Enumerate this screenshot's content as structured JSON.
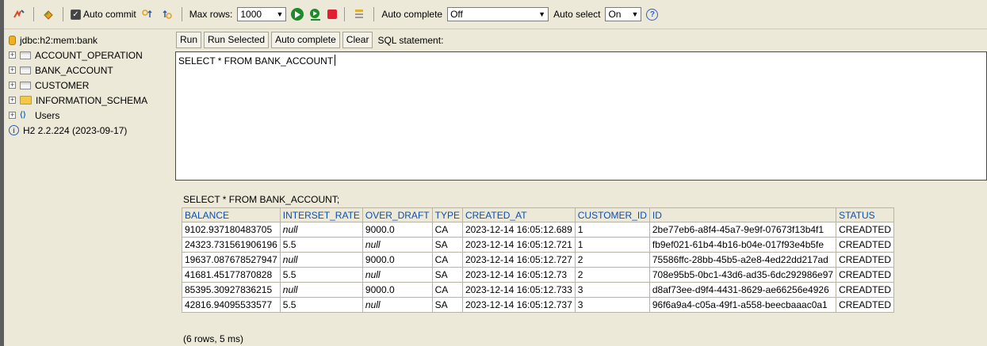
{
  "toolbar": {
    "auto_commit_label": "Auto commit",
    "max_rows_label": "Max rows:",
    "max_rows_value": "1000",
    "auto_complete_label": "Auto complete",
    "auto_complete_value": "Off",
    "auto_select_label": "Auto select",
    "auto_select_value": "On",
    "help_glyph": "?"
  },
  "tree": {
    "connection": "jdbc:h2:mem:bank",
    "items": [
      {
        "label": "ACCOUNT_OPERATION",
        "icon": "table-icon"
      },
      {
        "label": "BANK_ACCOUNT",
        "icon": "table-icon"
      },
      {
        "label": "CUSTOMER",
        "icon": "table-icon"
      },
      {
        "label": "INFORMATION_SCHEMA",
        "icon": "folder-icon"
      },
      {
        "label": "Users",
        "icon": "users-icon"
      }
    ],
    "version": "H2 2.2.224 (2023-09-17)"
  },
  "editor": {
    "buttons": [
      "Run",
      "Run Selected",
      "Auto complete",
      "Clear"
    ],
    "sql_label": "SQL statement:",
    "sql_text": "SELECT * FROM BANK_ACCOUNT"
  },
  "result": {
    "title": "SELECT * FROM BANK_ACCOUNT;",
    "columns": [
      "BALANCE",
      "INTERSET_RATE",
      "OVER_DRAFT",
      "TYPE",
      "CREATED_AT",
      "CUSTOMER_ID",
      "ID",
      "STATUS"
    ],
    "rows": [
      [
        "9102.937180483705",
        "null",
        "9000.0",
        "CA",
        "2023-12-14 16:05:12.689",
        "1",
        "2be77eb6-a8f4-45a7-9e9f-07673f13b4f1",
        "CREADTED"
      ],
      [
        "24323.731561906196",
        "5.5",
        "null",
        "SA",
        "2023-12-14 16:05:12.721",
        "1",
        "fb9ef021-61b4-4b16-b04e-017f93e4b5fe",
        "CREADTED"
      ],
      [
        "19637.087678527947",
        "null",
        "9000.0",
        "CA",
        "2023-12-14 16:05:12.727",
        "2",
        "75586ffc-28bb-45b5-a2e8-4ed22dd217ad",
        "CREADTED"
      ],
      [
        "41681.45177870828",
        "5.5",
        "null",
        "SA",
        "2023-12-14 16:05:12.73",
        "2",
        "708e95b5-0bc1-43d6-ad35-6dc292986e97",
        "CREADTED"
      ],
      [
        "85395.30927836215",
        "null",
        "9000.0",
        "CA",
        "2023-12-14 16:05:12.733",
        "3",
        "d8af73ee-d9f4-4431-8629-ae66256e4926",
        "CREADTED"
      ],
      [
        "42816.94095533577",
        "5.5",
        "null",
        "SA",
        "2023-12-14 16:05:12.737",
        "3",
        "96f6a9a4-c05a-49f1-a558-beecbaaac0a1",
        "CREADTED"
      ]
    ],
    "count": "(6 rows, 5 ms)"
  },
  "colors": {
    "panel_bg": "#ece9d8",
    "header_link": "#0b4fb3",
    "run_green": "#1f8a2a",
    "stop_red": "#e02030"
  }
}
